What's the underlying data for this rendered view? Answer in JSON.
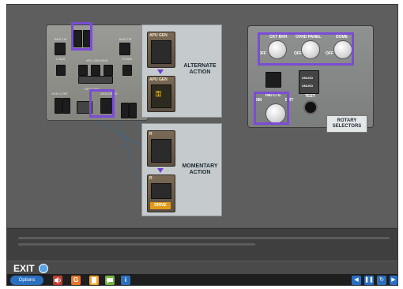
{
  "left_panel": {
    "labels": {
      "bus_tie_left": "BUS TIE",
      "bus_tie_right": "BUS TIE",
      "apu_gen_bus": "APU GEN BUS",
      "l_bus": "L BUS",
      "r_bus": "R BUS",
      "gen_disc": "GEN DISC",
      "gen_control": "GEN CONT",
      "gen_drive": "GEN DRIVE"
    }
  },
  "alternate_action": {
    "label_line1": "ALTERNATE",
    "label_line2": "ACTION",
    "top_unit_label": "APU GEN",
    "bottom_unit_label": "APU GEN"
  },
  "momentary_action": {
    "label_line1": "MOMENTARY",
    "label_line2": "ACTION",
    "top_unit_label": "R",
    "bottom_unit_label": "R",
    "drive_label": "DRIVE"
  },
  "rotary_panel": {
    "knobs": {
      "ckt_bkr": "CKT BKR",
      "ovhd_panel": "OVHD PANEL",
      "dome": "DOME",
      "ind_lts": "IND LTS"
    },
    "off": "OFF",
    "dim": "DIM",
    "brt": "BRT",
    "test": "TEST",
    "unlkd_1": "UNLKD",
    "unlkd_2": "UNLKD",
    "rotary_label_line1": "ROTARY",
    "rotary_label_line2": "SELECTORS"
  },
  "bottom": {
    "exit_label": "EXIT",
    "options_label": "Options",
    "tool_icons": [
      "speaker-icon",
      "glossary-icon",
      "notes-icon",
      "chat-icon",
      "info-icon"
    ],
    "tool_glyphs": {
      "glossary": "G",
      "info": "i"
    },
    "nav_glyphs": {
      "prev": "◀",
      "pause": "❚❚",
      "replay": "↻",
      "next": "▶"
    }
  },
  "colors": {
    "highlight": "#7b4cd6",
    "options": "#2b6fbf"
  }
}
